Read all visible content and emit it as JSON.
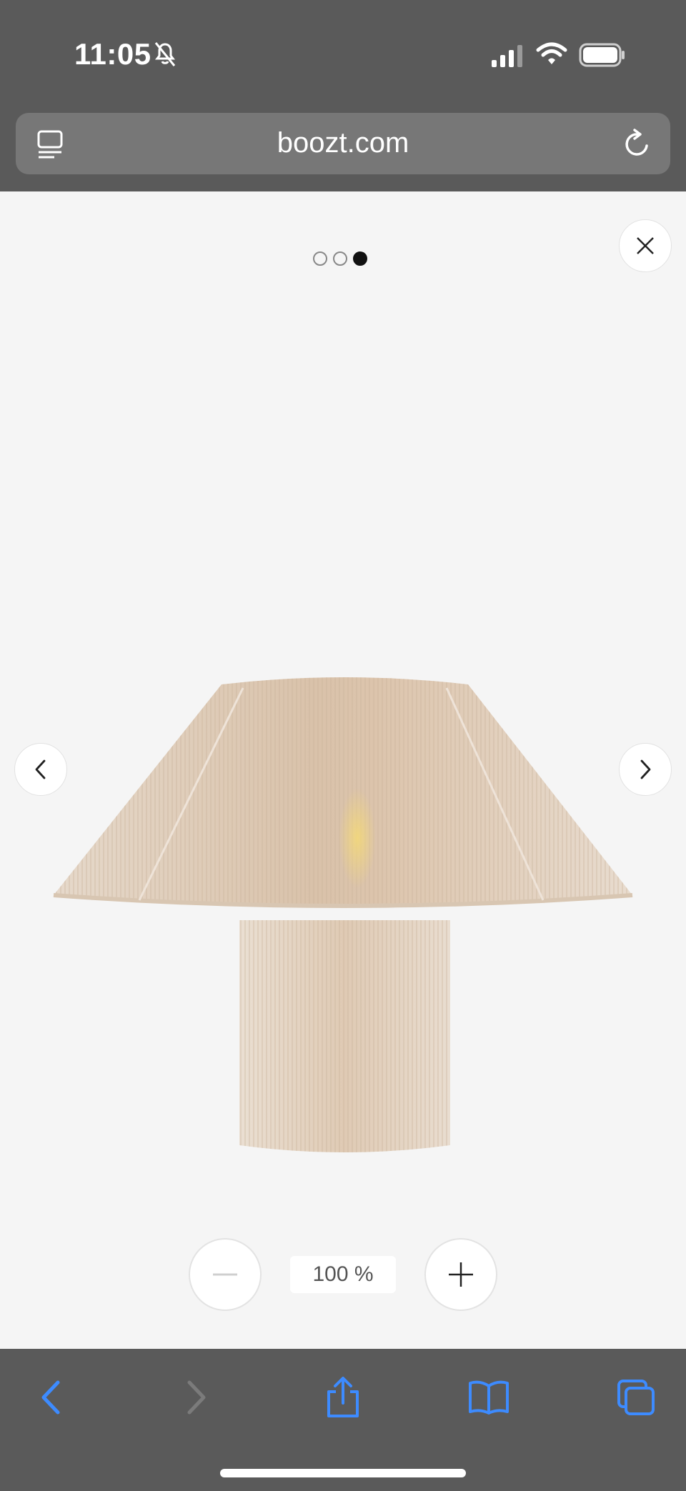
{
  "status_bar": {
    "time": "11:05",
    "icons": [
      "bell-slash-icon",
      "cellular-signal-icon",
      "wifi-icon",
      "battery-icon"
    ]
  },
  "browser": {
    "url": "boozt.com",
    "left_icon": "tabs-icon",
    "right_icon": "reload-icon"
  },
  "viewer": {
    "pagination": {
      "total": 3,
      "active": 3
    },
    "image_alt": "Woven rope table lamp",
    "zoom_level": "100 %",
    "buttons": {
      "close": "close-icon",
      "prev": "chevron-left-icon",
      "next": "chevron-right-icon",
      "zoom_out": "minus-icon",
      "zoom_in": "plus-icon"
    }
  },
  "toolbar": {
    "items": [
      "back-icon",
      "forward-icon",
      "share-icon",
      "bookmarks-icon",
      "tabs-overview-icon"
    ]
  },
  "colors": {
    "chrome": "#5a5a5a",
    "accent": "#3d8bff",
    "viewer_bg": "#f5f5f5"
  }
}
